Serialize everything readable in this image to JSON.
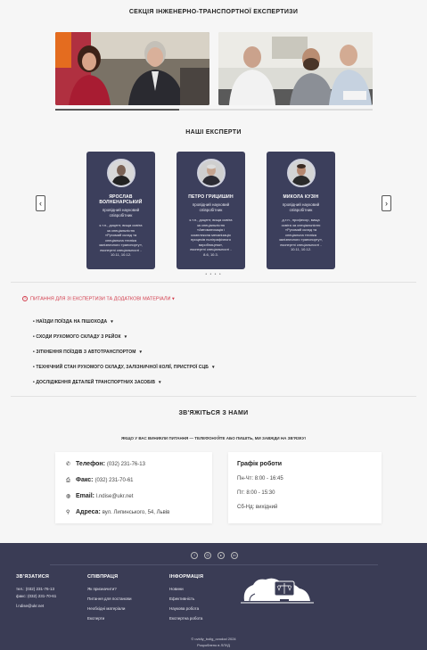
{
  "section_title": "СЕКЦІЯ ІНЖЕНЕРНО-ТРАНСПОРТНОЇ ЕКСПЕРТИЗИ",
  "photo_slider_progress": 0.39,
  "experts": {
    "title": "НАШІ ЕКСПЕРТИ",
    "prev": "‹",
    "next": "›",
    "dots": "• • • •",
    "items": [
      {
        "name1": "ЯРОСЛАВ",
        "name2": "ВОЛНЕНАРСЬКИЙ",
        "role1": "провідний науковий",
        "role2": "співробітник",
        "bio": [
          "к.т.н., доцент, вища освіта",
          "за спеціальністю",
          "«Рухомий склад та",
          "спеціальна техніка",
          "залізничного транспорту»,",
          "експертні спеціальності -",
          "10.11, 10.12."
        ]
      },
      {
        "name1": "ПЕТРО ГРИЦИШИН",
        "name2": "",
        "role1": "провідний науковий",
        "role2": "співробітник",
        "bio": [
          "к.т.н., доцент, вища освіта",
          "за спеціальністю",
          "«Автоматизація і",
          "комплексна механізація",
          "процесів поліграфічного",
          "виробництва»,",
          "експертні спеціальності -",
          "8.6, 10.3."
        ]
      },
      {
        "name1": "МИКОЛА КУЗІН",
        "name2": "",
        "role1": "провідний науковий",
        "role2": "співробітник",
        "bio": [
          "д.т.н., професор, вища",
          "освіта за спеціальністю",
          "«Рухомий склад та",
          "спеціальна техніка",
          "залізничного транспорту»,",
          "експертні спеціальності -",
          "10.11, 10.12."
        ]
      }
    ]
  },
  "faq": {
    "title": "ПИТАННЯ ДЛЯ ЗІ ЕКСПЕРТИЗИ ТА ДОДАТКОВІ МАТЕРІАЛИ",
    "items": [
      "НАЇЗДИ ПОЇЗДА НА ПІШОХОДА",
      "СХОДИ РУХОМОГО СКЛАДУ З РЕЙОК",
      "ЗІТКНЕННЯ ПОЇЗДІВ З АВТОТРАНСПОРТОМ",
      "ТЕХНІЧНИЙ СТАН РУХОМОГО СКЛАДУ, ЗАЛІЗНИЧНОЇ КОЛІЇ, ПРИСТРОЇ СЦБ",
      "ДОСЛІДЖЕННЯ ДЕТАЛЕЙ ТРАНСПОРТНИХ ЗАСОБІВ"
    ]
  },
  "contact": {
    "title": "ЗВ'ЯЖІТЬСЯ З НАМИ",
    "subtitle": "ЯКЩО У ВАС ВИНИКЛИ ПИТАННЯ — ТЕЛЕФОНУЙТЕ АБО ПИШІТЬ, МИ ЗАВЖДИ НА ЗВ'ЯЗКУ!",
    "phone_label": "Телефон:",
    "phone": "(032) 231-76-13",
    "fax_label": "Факс:",
    "fax": "(032) 231-70-61",
    "email_label": "Email:",
    "email": "l.ndise@ukr.net",
    "address_label": "Адреса:",
    "address": "вул. Липинського, 54, Львів",
    "schedule_title": "Графік роботи",
    "schedule": [
      "Пн-Чт: 8:00 - 16:45",
      "Пт: 8:00 - 15:30",
      "Сб-Нд: вихідний"
    ]
  },
  "footer": {
    "social": [
      "f",
      "◎",
      "▸",
      "in"
    ],
    "col1_title": "ЗВ'ЯЗАТИСЯ",
    "col1": [
      "тел.: (032) 231-76-13",
      "факс: (032) 231-70-61",
      "",
      "l.ndise@ukr.net"
    ],
    "col2_title": "СПІВПРАЦЯ",
    "col2": [
      "Як призначити?",
      "Питання для постанови",
      "Необхідні матеріали",
      "Експерти"
    ],
    "col3_title": "ІНФОРМАЦІЯ",
    "col3": [
      "Новини",
      "Ефективність",
      "Наукова робота",
      "Експертна робота"
    ],
    "copyright": "© ovidiy_bolig_ovodod 2024",
    "credit": "Розроблено в ЛЛУД"
  },
  "colors": {
    "accent_red": "#d23b4b",
    "card_bg": "#3c3f5c",
    "footer_bg": "#3a3c55"
  }
}
